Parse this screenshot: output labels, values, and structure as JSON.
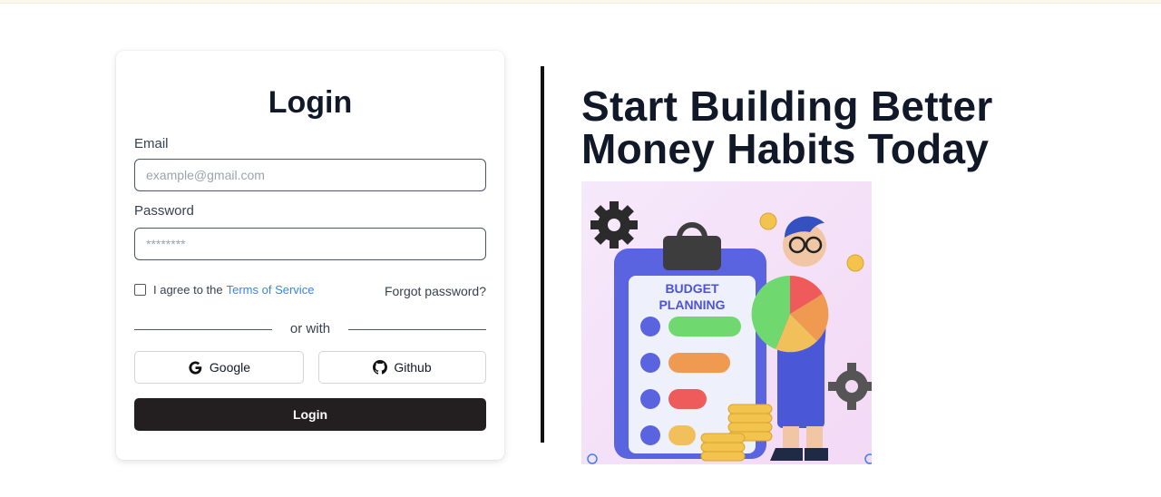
{
  "login_card": {
    "title": "Login",
    "email_label": "Email",
    "email_placeholder": "example@gmail.com",
    "password_label": "Password",
    "password_placeholder": "********",
    "agree_text": "I agree to the",
    "terms_link": "Terms of Service",
    "forgot_password": "Forgot password?",
    "divider_text": "or with",
    "google_label": "Google",
    "github_label": "Github",
    "login_button": "Login"
  },
  "promo": {
    "headline_line1": "Start Building Better",
    "headline_line2": "Money Habits Today",
    "illustration": {
      "clipboard_title_line1": "BUDGET",
      "clipboard_title_line2": "PLANNING"
    }
  },
  "colors": {
    "primary_button": "#231f20",
    "link": "#3b82f6",
    "heading": "#111827"
  }
}
